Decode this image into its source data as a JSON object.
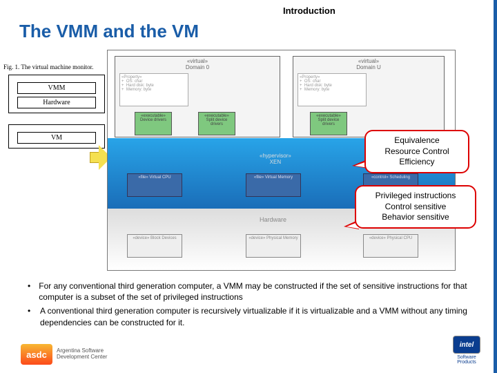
{
  "header": {
    "section": "Introduction",
    "title": "The VMM and the VM"
  },
  "fig1": {
    "caption": "Fig. 1.  The virtual machine monitor.",
    "vmm": "VMM",
    "hardware": "Hardware",
    "vm": "VM"
  },
  "diagram": {
    "dom0": {
      "title": "«virtual»\nDomain 0",
      "props": "«Property»\n+  OS: char\n+  Hard disk: byte\n+  Memory: byte",
      "drv1": "«executable»\nDevice\ndrivers",
      "drv2": "«executable»\nSplit device\ndrivers"
    },
    "domu": {
      "title": "«virtual»\nDomain U",
      "props": "«Property»\n+  OS: char\n+  Hard disk: byte\n+  Memory: byte",
      "drv": "«executable»\nSplit device\ndrivers"
    },
    "xen": {
      "label": "«hypervisor»\nXEN",
      "s1": "«file»\nVirtual CPU",
      "s2": "«file»\nVirtual Memory",
      "s3": "«control»\nScheduling"
    },
    "hw": {
      "label": "Hardware",
      "h1": "«device»\nBlock Devices",
      "h2": "«device»\nPhysical Memory",
      "h3": "«device»\nPhysical CPU"
    }
  },
  "callouts": {
    "c1": {
      "l1": "Equivalence",
      "l2": "Resource Control",
      "l3": "Efficiency"
    },
    "c2": {
      "l1": "Privileged instructions",
      "l2": "Control sensitive",
      "l3": "Behavior sensitive"
    }
  },
  "bullets": {
    "b1": "For any conventional third generation computer, a VMM may be constructed if the set of sensitive instructions for that computer is a subset of the set of privileged instructions",
    "b2": "A conventional third generation computer is recursively virtualizable if it is virtualizable and  a VMM without any timing dependencies can be constructed for it."
  },
  "footer": {
    "asdc_mark": "asdc",
    "asdc_text": "Argentina Software\nDevelopment Center",
    "intel": "intel",
    "intel_sub": "Software\nProducts"
  }
}
